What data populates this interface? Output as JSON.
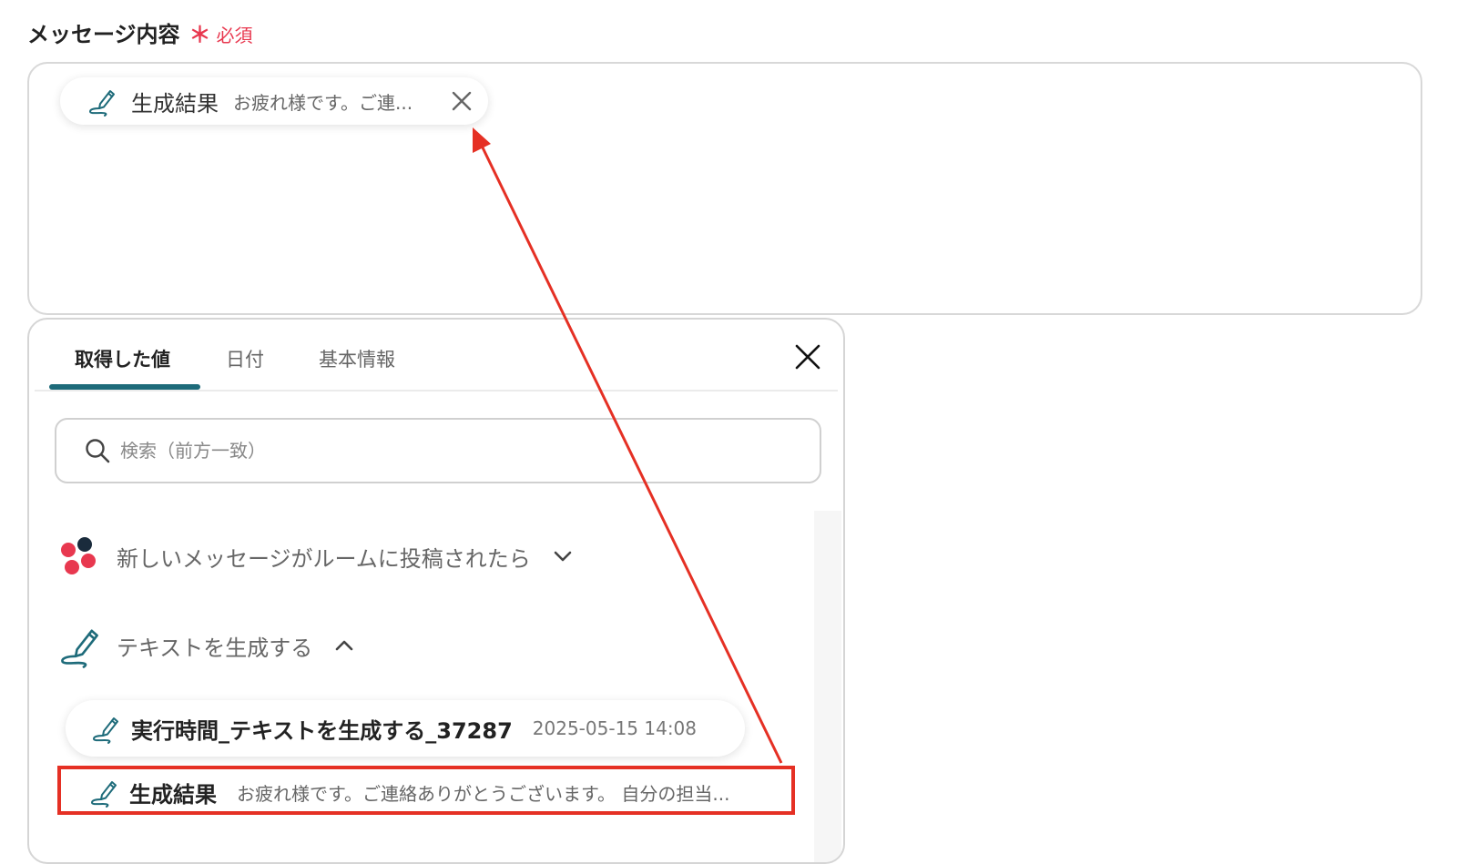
{
  "field": {
    "label": "メッセージ内容",
    "required_mark": "＊",
    "required_text": "必須"
  },
  "selected_chip": {
    "icon": "pen-icon",
    "title": "生成結果",
    "preview": "お疲れ様です。ご連..."
  },
  "popup": {
    "tabs": [
      {
        "label": "取得した値",
        "active": true
      },
      {
        "label": "日付",
        "active": false
      },
      {
        "label": "基本情報",
        "active": false
      }
    ],
    "search_placeholder": "検索（前方一致）",
    "sections": [
      {
        "label": "新しいメッセージがルームに投稿されたら",
        "icon": "app-logo-icon",
        "expanded": false
      },
      {
        "label": "テキストを生成する",
        "icon": "pen-icon",
        "expanded": true
      }
    ],
    "items": [
      {
        "title": "実行時間_テキストを生成する_37287",
        "meta": "2025-05-15 14:08"
      },
      {
        "title": "生成結果",
        "meta": "お疲れ様です。ご連絡ありがとうございます。 自分の担当..."
      }
    ]
  },
  "colors": {
    "accent": "#1e6b7a",
    "required": "#e8384f",
    "annotation": "#e53024"
  }
}
